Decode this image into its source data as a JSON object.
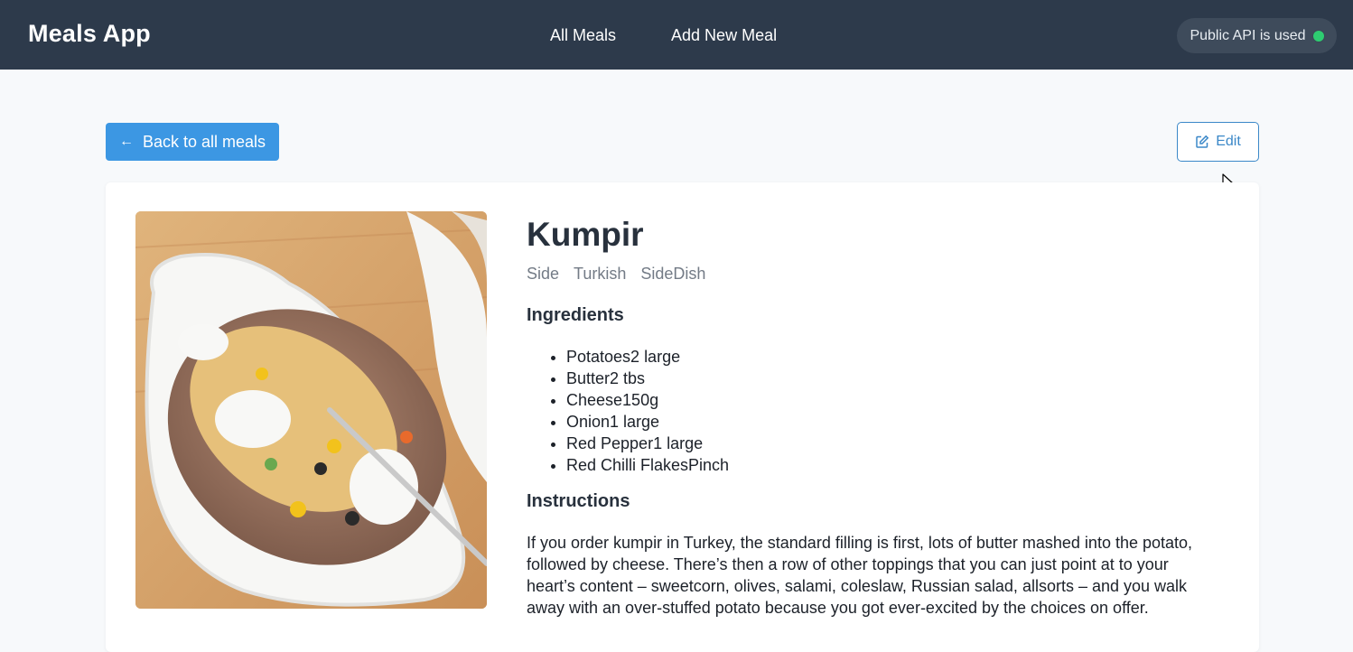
{
  "header": {
    "brand": "Meals App",
    "nav": [
      "All Meals",
      "Add New Meal"
    ],
    "api_status": "Public API is used",
    "api_status_color": "#2ecc71"
  },
  "actions": {
    "back_label": "Back to all meals",
    "edit_label": "Edit"
  },
  "meal": {
    "title": "Kumpir",
    "tags": [
      "Side",
      "Turkish",
      "SideDish"
    ],
    "ingredients_heading": "Ingredients",
    "ingredients": [
      "Potatoes2 large",
      "Butter2 tbs",
      "Cheese150g",
      "Onion1 large",
      "Red Pepper1 large",
      "Red Chilli FlakesPinch"
    ],
    "instructions_heading": "Instructions",
    "instructions": "If you order kumpir in Turkey, the standard filling is first, lots of butter mashed into the potato, followed by cheese. There’s then a row of other toppings that you can just point at to your heart’s content – sweetcorn, olives, salami, coleslaw, Russian salad, allsorts – and you walk away with an over-stuffed potato because you got ever-excited by the choices on offer."
  },
  "colors": {
    "header_bg": "#2d3a4b",
    "primary": "#3c97e3",
    "edit_accent": "#3b88c8"
  }
}
